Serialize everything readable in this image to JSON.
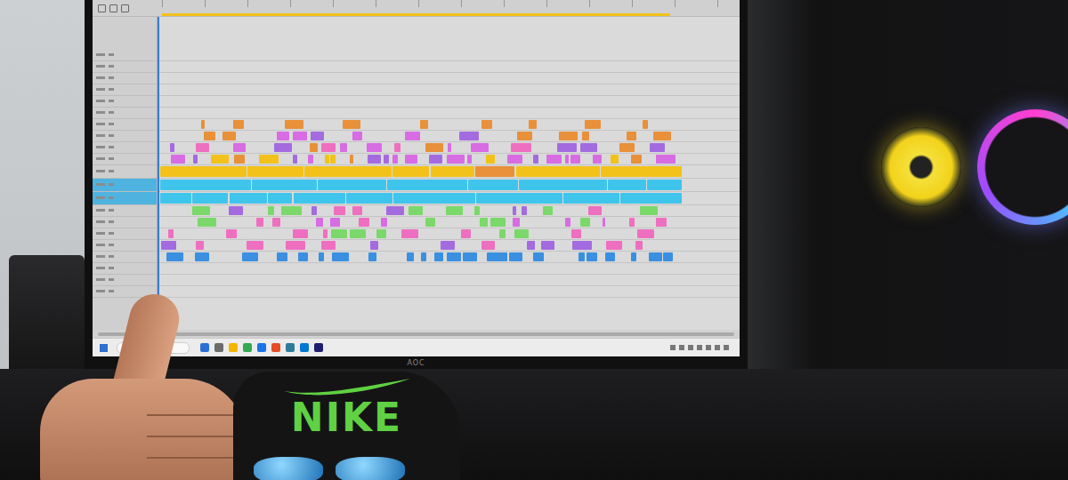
{
  "monitor": {
    "brand": "AOC"
  },
  "cloth": {
    "text": "NIKE"
  },
  "timeline": {
    "playhead": {
      "level": 0.0
    },
    "tracks": [
      {
        "kind": "empty",
        "selected": false,
        "level": 0,
        "colors": []
      },
      {
        "kind": "empty",
        "selected": false,
        "level": 0,
        "colors": []
      },
      {
        "kind": "empty",
        "selected": false,
        "level": 0,
        "colors": []
      },
      {
        "kind": "empty",
        "selected": false,
        "level": 0,
        "colors": []
      },
      {
        "kind": "empty",
        "selected": false,
        "level": 0,
        "colors": []
      },
      {
        "kind": "empty",
        "selected": false,
        "level": 0,
        "colors": []
      },
      {
        "kind": "clips",
        "selected": false,
        "level": 0.05,
        "colors": [
          "#e8903a"
        ]
      },
      {
        "kind": "clips",
        "selected": false,
        "level": 0.35,
        "colors": [
          "#d76ce3",
          "#a46be0",
          "#e8903a"
        ]
      },
      {
        "kind": "clips",
        "selected": false,
        "level": 0.6,
        "colors": [
          "#d76ce3",
          "#a46be0",
          "#e8903a",
          "#ee6fc0"
        ]
      },
      {
        "kind": "clips",
        "selected": false,
        "level": 0.8,
        "colors": [
          "#d76ce3",
          "#a46be0",
          "#e8903a",
          "#f2c21a"
        ]
      },
      {
        "kind": "solid",
        "selected": false,
        "level": 0.95,
        "colors": [
          "#f2c21a",
          "#e8903a"
        ]
      },
      {
        "kind": "solid",
        "selected": true,
        "level": 0.97,
        "colors": [
          "#3fc4ec",
          "#e8903a"
        ]
      },
      {
        "kind": "solid",
        "selected": true,
        "level": 0.97,
        "colors": [
          "#3fc4ec",
          "#5a8fc0"
        ]
      },
      {
        "kind": "clips",
        "selected": false,
        "level": 0.45,
        "colors": [
          "#7bd86a",
          "#ee6fc0",
          "#a46be0"
        ]
      },
      {
        "kind": "clips",
        "selected": false,
        "level": 0.35,
        "colors": [
          "#7bd86a",
          "#ee6fc0",
          "#d76ce3"
        ]
      },
      {
        "kind": "clips",
        "selected": false,
        "level": 0.2,
        "colors": [
          "#7bd86a",
          "#ee6fc0"
        ]
      },
      {
        "kind": "clips",
        "selected": false,
        "level": 0.12,
        "colors": [
          "#ee6fc0",
          "#a46be0"
        ]
      },
      {
        "kind": "clips",
        "selected": false,
        "level": 0.5,
        "colors": [
          "#3a8fe0"
        ]
      },
      {
        "kind": "empty",
        "selected": false,
        "level": 0,
        "colors": []
      },
      {
        "kind": "empty",
        "selected": false,
        "level": 0,
        "colors": []
      },
      {
        "kind": "empty",
        "selected": false,
        "level": 0,
        "colors": []
      }
    ]
  },
  "taskbar": {
    "icons": [
      {
        "color": "#2b6fd6"
      },
      {
        "color": "#6b6b6b"
      },
      {
        "color": "#f4b400"
      },
      {
        "color": "#34a853"
      },
      {
        "color": "#1a73e8"
      },
      {
        "color": "#e44d26"
      },
      {
        "color": "#2d7d9a"
      },
      {
        "color": "#0078d4"
      },
      {
        "color": "#1e1e6e"
      }
    ]
  }
}
